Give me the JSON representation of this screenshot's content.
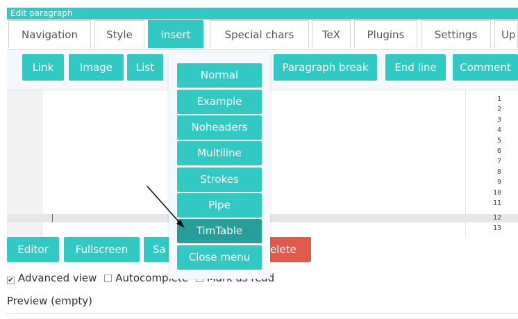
{
  "window": {
    "title": "Edit paragraph"
  },
  "tabs": [
    "Navigation",
    "Style",
    "Insert",
    "Special chars",
    "TeX",
    "Plugins",
    "Settings",
    "Up"
  ],
  "active_tab": "Insert",
  "toolbar": {
    "buttons": [
      "Link",
      "Image",
      "List",
      "Paragraph break",
      "End line",
      "Comment"
    ]
  },
  "editor": {
    "line_numbers": [
      "1",
      "2",
      "3",
      "4",
      "5",
      "6",
      "7",
      "8",
      "9",
      "10",
      "11",
      "12",
      "13"
    ],
    "active_line": "12"
  },
  "actions": {
    "editor": "Editor",
    "fullscreen": "Fullscreen",
    "save_partial": "Sa",
    "delete_partial": "elete"
  },
  "options": {
    "advanced_view": "Advanced view",
    "advanced_view_checked": true,
    "autocomplete_partial": "Autocomplete",
    "autocomplete_checked": false,
    "mark_as_read_partial": "Mark as read"
  },
  "preview": "Preview (empty)",
  "dropdown": {
    "items": [
      "Normal",
      "Example",
      "Noheaders",
      "Multiline",
      "Strokes",
      "Pipe",
      "TimTable",
      "Close menu"
    ],
    "highlighted": "TimTable"
  },
  "colors": {
    "accent": "#33c9c3",
    "accent_dark": "#279e99",
    "danger": "#e05a4e"
  }
}
